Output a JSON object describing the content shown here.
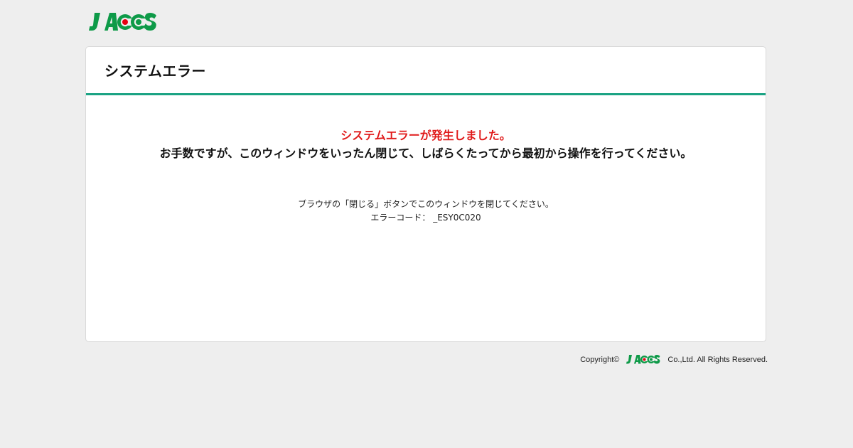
{
  "brand": {
    "name": "JACCS",
    "colors": {
      "green": "#0e9a48",
      "red": "#e60012",
      "accent": "#1aa383",
      "error_text": "#e01a1a"
    }
  },
  "card": {
    "title": "システムエラー"
  },
  "message": {
    "error_line": "システムエラーが発生しました。",
    "main_line": "お手数ですが、このウィンドウをいったん閉じて、しばらくたってから最初から操作を行ってください。"
  },
  "details": {
    "instruction": "ブラウザの「閉じる」ボタンでこのウィンドウを閉じてください。",
    "error_code_label": "エラーコード：",
    "error_code": "_ESY0C020"
  },
  "footer": {
    "copyright_prefix": "Copyright©",
    "copyright_suffix": "Co.,Ltd. All Rights Reserved."
  }
}
